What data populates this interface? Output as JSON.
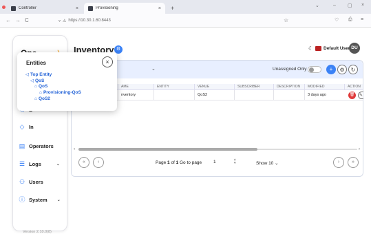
{
  "browser": {
    "tabs": [
      {
        "label": "Controller",
        "active": false
      },
      {
        "label": "Provisioning",
        "active": true
      }
    ],
    "new_tab": "+",
    "url": "https://10.30.1.60:8443"
  },
  "sidebar": {
    "brand": "Ope",
    "items": [
      {
        "label": "E",
        "icon": "entities-icon"
      },
      {
        "label": "In",
        "icon": "inventory-icon"
      },
      {
        "label": "Operators",
        "icon": "operators-icon"
      },
      {
        "label": "Logs",
        "icon": "logs-icon"
      },
      {
        "label": "Users",
        "icon": "users-icon"
      },
      {
        "label": "System",
        "icon": "system-icon"
      }
    ],
    "version": "Version 2.10.0(8)"
  },
  "entities_popup": {
    "title": "Entities",
    "close": "×",
    "tree": [
      {
        "label": "Top Entity",
        "level": 0
      },
      {
        "label": "QoS",
        "level": 1
      },
      {
        "label": "QoS",
        "level": 2
      },
      {
        "label": "Provisioning-QoS",
        "level": 3
      },
      {
        "label": "QoS2",
        "level": 2
      }
    ]
  },
  "header": {
    "title": "Inventory",
    "user_name": "Default User",
    "avatar": "DU"
  },
  "toolbar": {
    "unassigned_label": "Unassigned Only",
    "unassigned_on": false
  },
  "table": {
    "columns": [
      "AME",
      "ENTITY",
      "VENUE",
      "SUBSCRIBER",
      "DESCRIPTION",
      "MODIFIED",
      "ACTION"
    ],
    "rows": [
      [
        "nventory",
        "",
        "QoS2",
        "",
        "",
        "3 days ago",
        ""
      ]
    ]
  },
  "pagination": {
    "page_prefix": "Page",
    "page_current": "1",
    "page_of": "of",
    "page_total": "1",
    "goto_label": "Go to page",
    "goto_value": "1",
    "show_label": "Show 10"
  },
  "colors": {
    "accent": "#3b82f6",
    "tree_link": "#1e5fd6",
    "toolbar_bg": "#e8efff",
    "delete": "#e03a3a"
  }
}
